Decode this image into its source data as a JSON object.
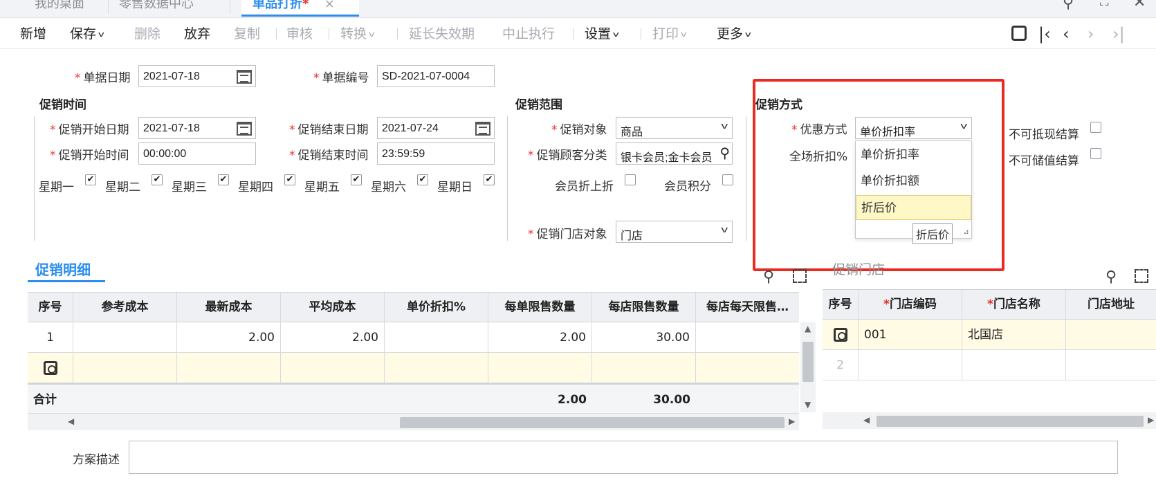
{
  "tabs": {
    "desktop": "我的桌面",
    "retail": "零售数据中心",
    "single_discount": "单品打折",
    "modified": "*",
    "close": "×"
  },
  "toolbar": {
    "new": "新增",
    "save": "保存",
    "delete": "删除",
    "discard": "放弃",
    "copy": "复制",
    "review": "审核",
    "convert": "转换",
    "extend": "延长失效期",
    "stop": "中止执行",
    "settings": "设置",
    "print": "打印",
    "more": "更多"
  },
  "header": {
    "doc_date_label": "单据日期",
    "doc_date": "2021-07-18",
    "doc_no_label": "单据编号",
    "doc_no": "SD-2021-07-0004"
  },
  "promo_time": {
    "title": "促销时间",
    "start_date_label": "促销开始日期",
    "start_date": "2021-07-18",
    "end_date_label": "促销结束日期",
    "end_date": "2021-07-24",
    "start_time_label": "促销开始时间",
    "start_time": "00:00:00",
    "end_time_label": "促销结束时间",
    "end_time": "23:59:59",
    "weekdays": [
      {
        "label": "星期一",
        "checked": true
      },
      {
        "label": "星期二",
        "checked": true
      },
      {
        "label": "星期三",
        "checked": true
      },
      {
        "label": "星期四",
        "checked": true
      },
      {
        "label": "星期五",
        "checked": true
      },
      {
        "label": "星期六",
        "checked": true
      },
      {
        "label": "星期日",
        "checked": true
      }
    ],
    "check_mark": "✔"
  },
  "promo_scope": {
    "title": "促销范围",
    "target_label": "促销对象",
    "target": "商品",
    "member_cat_label": "促销顾客分类",
    "member_cat": "银卡会员;金卡会员",
    "member_discount_label": "会员折上折",
    "member_points_label": "会员积分",
    "store_target_label": "促销门店对象",
    "store_target": "门店"
  },
  "promo_method": {
    "title": "促销方式",
    "discount_type_label": "优惠方式",
    "discount_type": "单价折扣率",
    "full_discount_label": "全场折扣%",
    "no_cash_label": "不可抵现结算",
    "no_stored_label": "不可储值结算",
    "options": [
      "单价折扣率",
      "单价折扣额",
      "折后价"
    ],
    "highlighted_option": "折后价",
    "tooltip": "折后价"
  },
  "detail": {
    "tab": "促销明细",
    "columns": [
      "序号",
      "参考成本",
      "最新成本",
      "平均成本",
      "单价折扣%",
      "每单限售数量",
      "每店限售数量",
      "每店每天限售…"
    ],
    "rows": [
      {
        "no": "1",
        "ref_cost": "",
        "latest_cost": "2.00",
        "avg_cost": "2.00",
        "discount": "",
        "per_order": "2.00",
        "per_store": "30.00",
        "per_day": ""
      }
    ],
    "total_label": "合计",
    "total_per_order": "2.00",
    "total_per_store": "30.00"
  },
  "stores": {
    "title": "促销门店",
    "columns": [
      "序号",
      "门店编码",
      "门店名称",
      "门店地址"
    ],
    "required_mark": "*",
    "rows": [
      {
        "code": "001",
        "name": "北国店",
        "address": ""
      }
    ],
    "empty_row_no": "2"
  },
  "footer": {
    "desc_label": "方案描述",
    "desc_value": ""
  }
}
